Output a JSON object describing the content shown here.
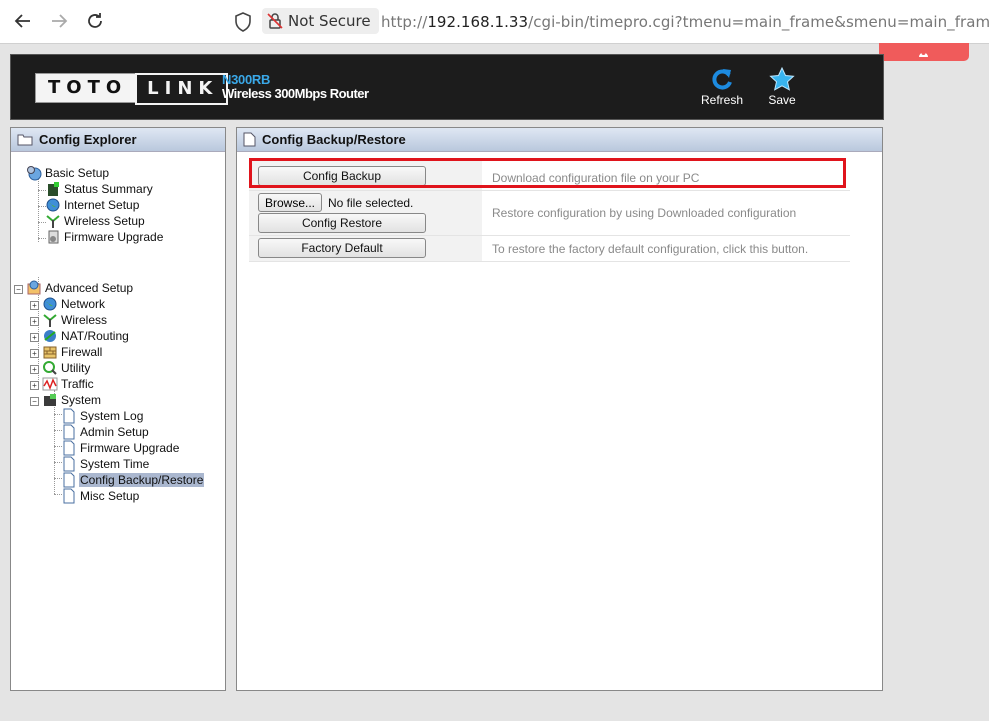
{
  "browser": {
    "security_label": "Not Secure",
    "url_prefix": "http://",
    "url_host": "192.168.1.33",
    "url_path": "/cgi-bin/timepro.cgi?tmenu=main_frame&smenu=main_frame"
  },
  "header": {
    "brand_left": "TOTO",
    "brand_right": "LINK",
    "model": "N300RB",
    "model_desc": "Wireless 300Mbps Router",
    "refresh_label": "Refresh",
    "save_label": "Save"
  },
  "sidebar": {
    "title": "Config Explorer",
    "basic_setup": {
      "label": "Basic Setup",
      "items": [
        "Status Summary",
        "Internet Setup",
        "Wireless Setup",
        "Firmware Upgrade"
      ]
    },
    "advanced_setup": {
      "label": "Advanced Setup",
      "items": [
        "Network",
        "Wireless",
        "NAT/Routing",
        "Firewall",
        "Utility",
        "Traffic",
        "System"
      ]
    },
    "system_items": [
      "System Log",
      "Admin Setup",
      "Firmware Upgrade",
      "System Time",
      "Config Backup/Restore",
      "Misc Setup"
    ],
    "selected": "Config Backup/Restore"
  },
  "main": {
    "title": "Config Backup/Restore",
    "backup_button": "Config Backup",
    "backup_desc": "Download configuration file on your PC",
    "browse_button": "Browse...",
    "file_status": "No file selected.",
    "restore_button": "Config Restore",
    "restore_desc": "Restore configuration by using Downloaded configuration",
    "factory_button": "Factory Default",
    "factory_desc": "To restore the factory default configuration, click this button."
  },
  "colors": {
    "highlight": "#e0141c",
    "model_text": "#3aa8e8",
    "selected_bg": "#aab7cf"
  }
}
